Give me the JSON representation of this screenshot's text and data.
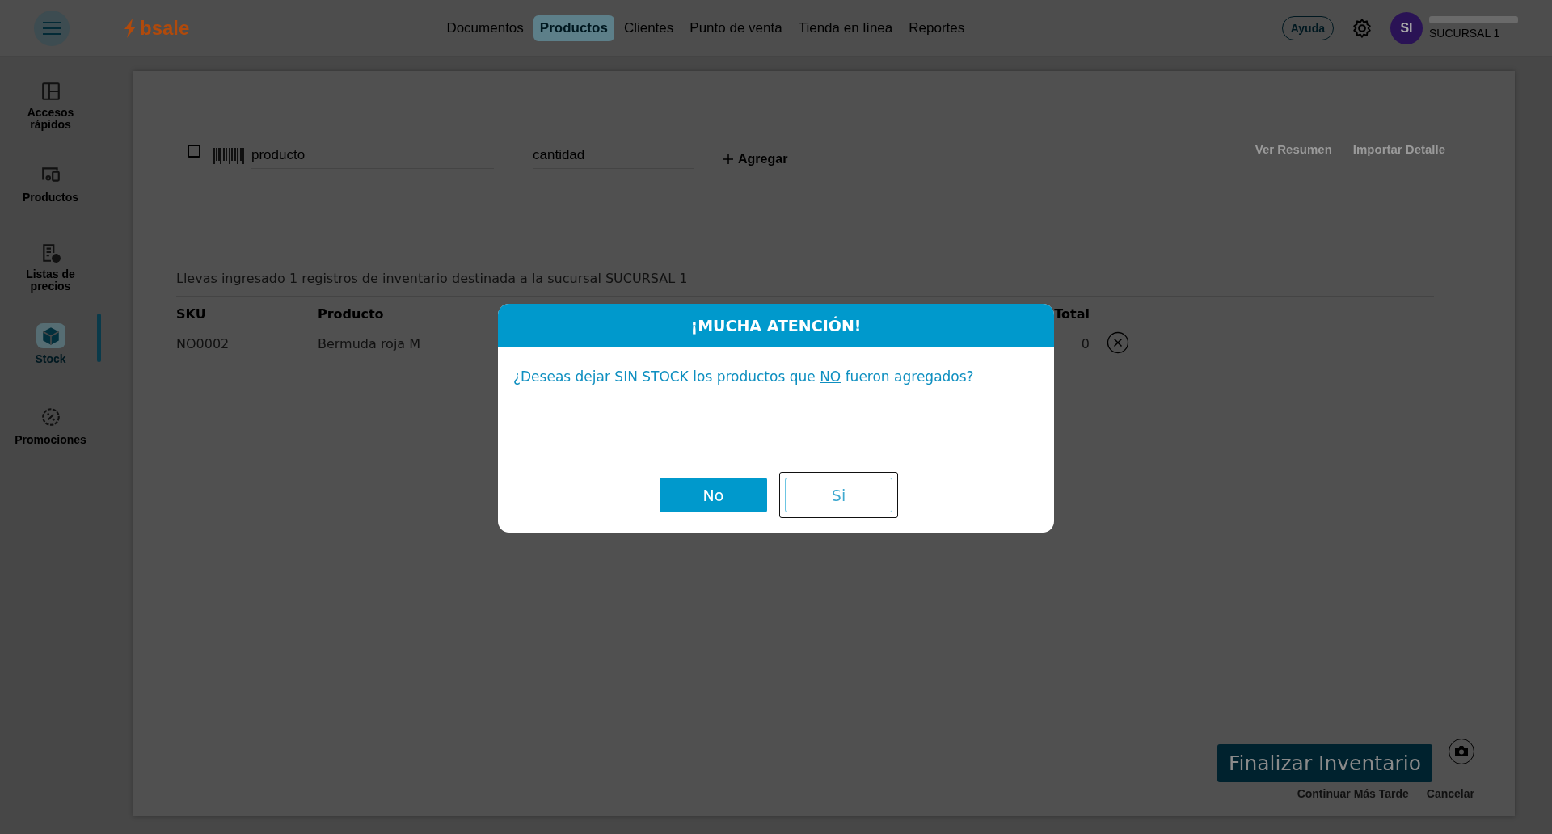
{
  "header": {
    "brand": "bsale",
    "nav": [
      {
        "label": "Documentos",
        "selected": false
      },
      {
        "label": "Productos",
        "selected": true
      },
      {
        "label": "Clientes",
        "selected": false
      },
      {
        "label": "Punto de venta",
        "selected": false
      },
      {
        "label": "Tienda en línea",
        "selected": false
      },
      {
        "label": "Reportes",
        "selected": false
      }
    ],
    "help": "Ayuda",
    "avatar": "SI",
    "branch": "SUCURSAL 1"
  },
  "sidebar": {
    "items": [
      {
        "label": "Accesos rápidos",
        "kind": "layout",
        "selected": false
      },
      {
        "label": "Productos",
        "kind": "devices",
        "selected": false
      },
      {
        "label": "Listas de precios",
        "kind": "pricelist",
        "selected": false
      },
      {
        "label": "Stock",
        "kind": "box",
        "selected": true
      },
      {
        "label": "Promociones",
        "kind": "promo",
        "selected": false
      }
    ]
  },
  "form": {
    "select_all": {
      "checked": false
    },
    "product": {
      "placeholder": "producto"
    },
    "quantity": {
      "placeholder": "cantidad"
    },
    "add": "Agregar",
    "links": [
      "Ver Resumen",
      "Importar Detalle"
    ]
  },
  "summary": "Llevas ingresado 1 registros de inventario destinada a la sucursal SUCURSAL 1",
  "table": {
    "columns": [
      "SKU",
      "Producto",
      "Total"
    ],
    "rows": [
      {
        "sku": "NO0002",
        "product": "Bermuda roja M",
        "total": "0"
      }
    ]
  },
  "footer": {
    "finish": "Finalizar Inventario",
    "later": "Continuar Más Tarde",
    "cancel": "Cancelar"
  },
  "dialog": {
    "title": "¡MUCHA ATENCIÓN!",
    "message": {
      "before": "¿Deseas dejar SIN STOCK los productos que ",
      "underlined": "NO",
      "after": " fueron agregados?"
    },
    "buttons": [
      {
        "label": "No",
        "kind": "primary",
        "focused": false
      },
      {
        "label": "Si",
        "kind": "outline",
        "focused": true
      }
    ]
  }
}
